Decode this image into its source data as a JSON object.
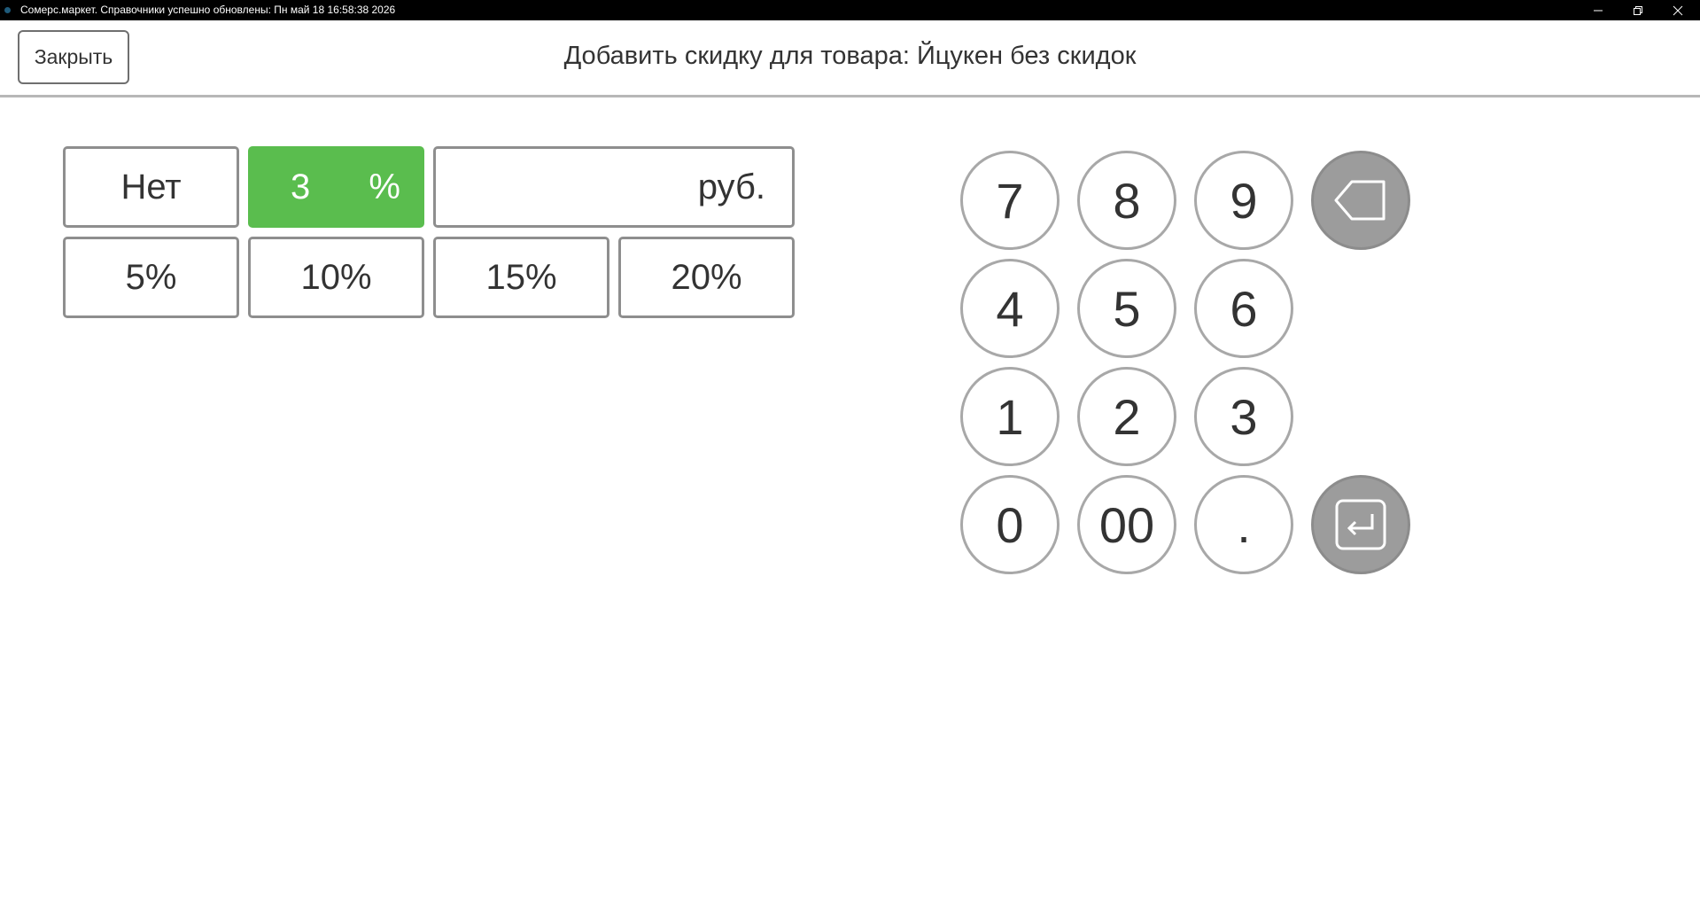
{
  "window": {
    "title": "Сомерс.маркет. Справочники успешно обновлены: Пн май 18 16:58:38 2026",
    "controls": [
      "minimize-icon",
      "restore-icon",
      "close-icon"
    ]
  },
  "header": {
    "close_label": "Закрыть",
    "title": "Добавить скидку для товара: Йцукен без скидок"
  },
  "discount": {
    "none_label": "Нет",
    "percent_value": "3",
    "percent_sign": "%",
    "rub_value": "",
    "rub_unit": "руб.",
    "presets": [
      "5%",
      "10%",
      "15%",
      "20%"
    ]
  },
  "keypad": {
    "keys": [
      "7",
      "8",
      "9",
      "4",
      "5",
      "6",
      "1",
      "2",
      "3",
      "0",
      "00",
      "."
    ],
    "backspace_icon": "backspace-icon",
    "enter_icon": "enter-icon"
  },
  "colors": {
    "active": "#5abd4e",
    "action_key": "#9c9c9c",
    "border": "#8e8e8e",
    "text": "#333333"
  }
}
